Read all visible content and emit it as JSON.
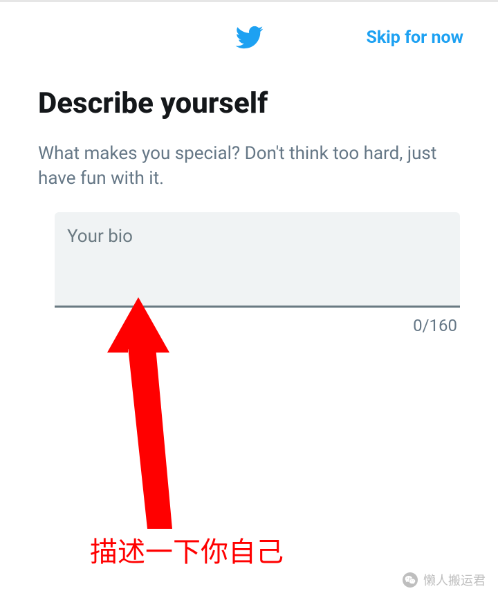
{
  "header": {
    "skip_label": "Skip for now"
  },
  "main": {
    "title": "Describe yourself",
    "subtitle": "What makes you special? Don't think too hard, just have fun with it.",
    "bio_placeholder": "Your bio",
    "char_count": "0/160"
  },
  "annotation": {
    "text": "描述一下你自己"
  },
  "watermark": {
    "text": "懒人搬运君"
  }
}
